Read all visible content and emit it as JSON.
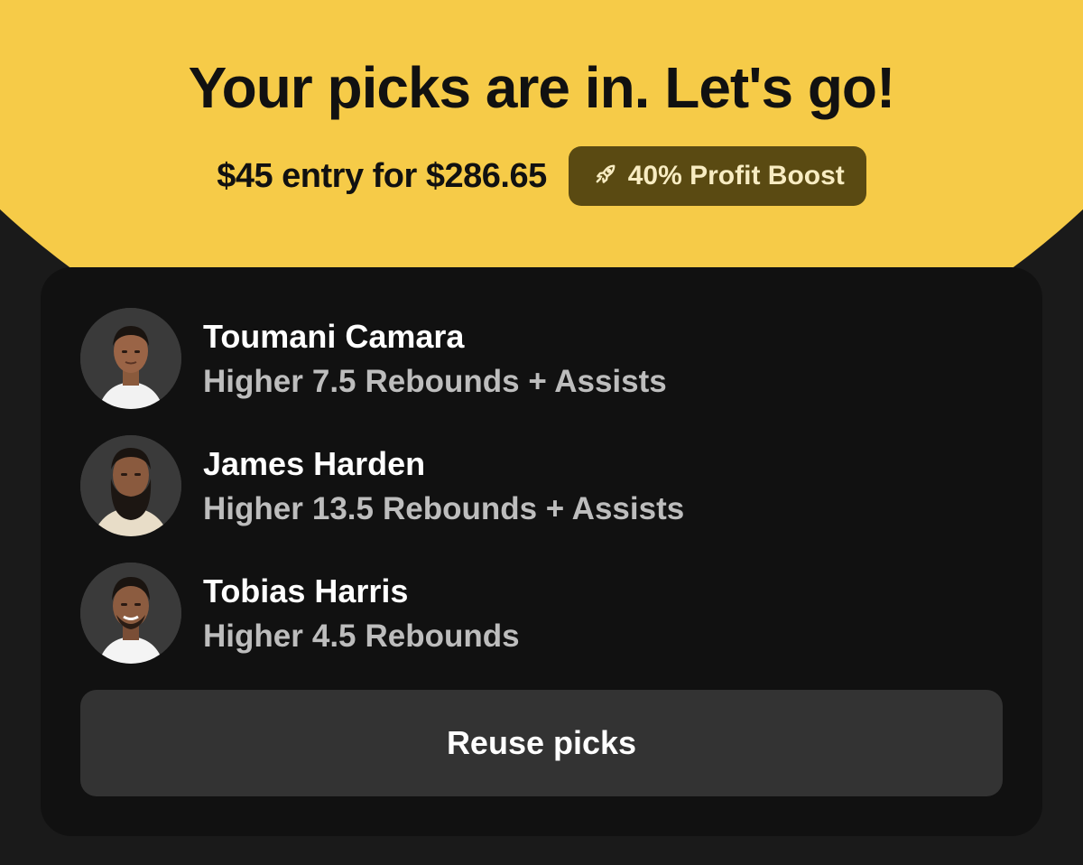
{
  "header": {
    "title": "Your picks are in. Let's go!",
    "entry_summary": "$45 entry for $286.65",
    "boost_icon": "rocket-icon",
    "boost_label": "40% Profit Boost"
  },
  "picks": [
    {
      "player": "Toumani Camara",
      "direction": "Higher",
      "line": "7.5",
      "stat": "Rebounds + Assists"
    },
    {
      "player": "James Harden",
      "direction": "Higher",
      "line": "13.5",
      "stat": "Rebounds + Assists"
    },
    {
      "player": "Tobias Harris",
      "direction": "Higher",
      "line": "4.5",
      "stat": "Rebounds"
    }
  ],
  "actions": {
    "reuse_label": "Reuse picks"
  },
  "colors": {
    "brand_yellow": "#f6cb48",
    "card_background": "#111111",
    "page_background": "#1a1a1a",
    "badge_background": "#5a4a12",
    "button_background": "#333333"
  }
}
